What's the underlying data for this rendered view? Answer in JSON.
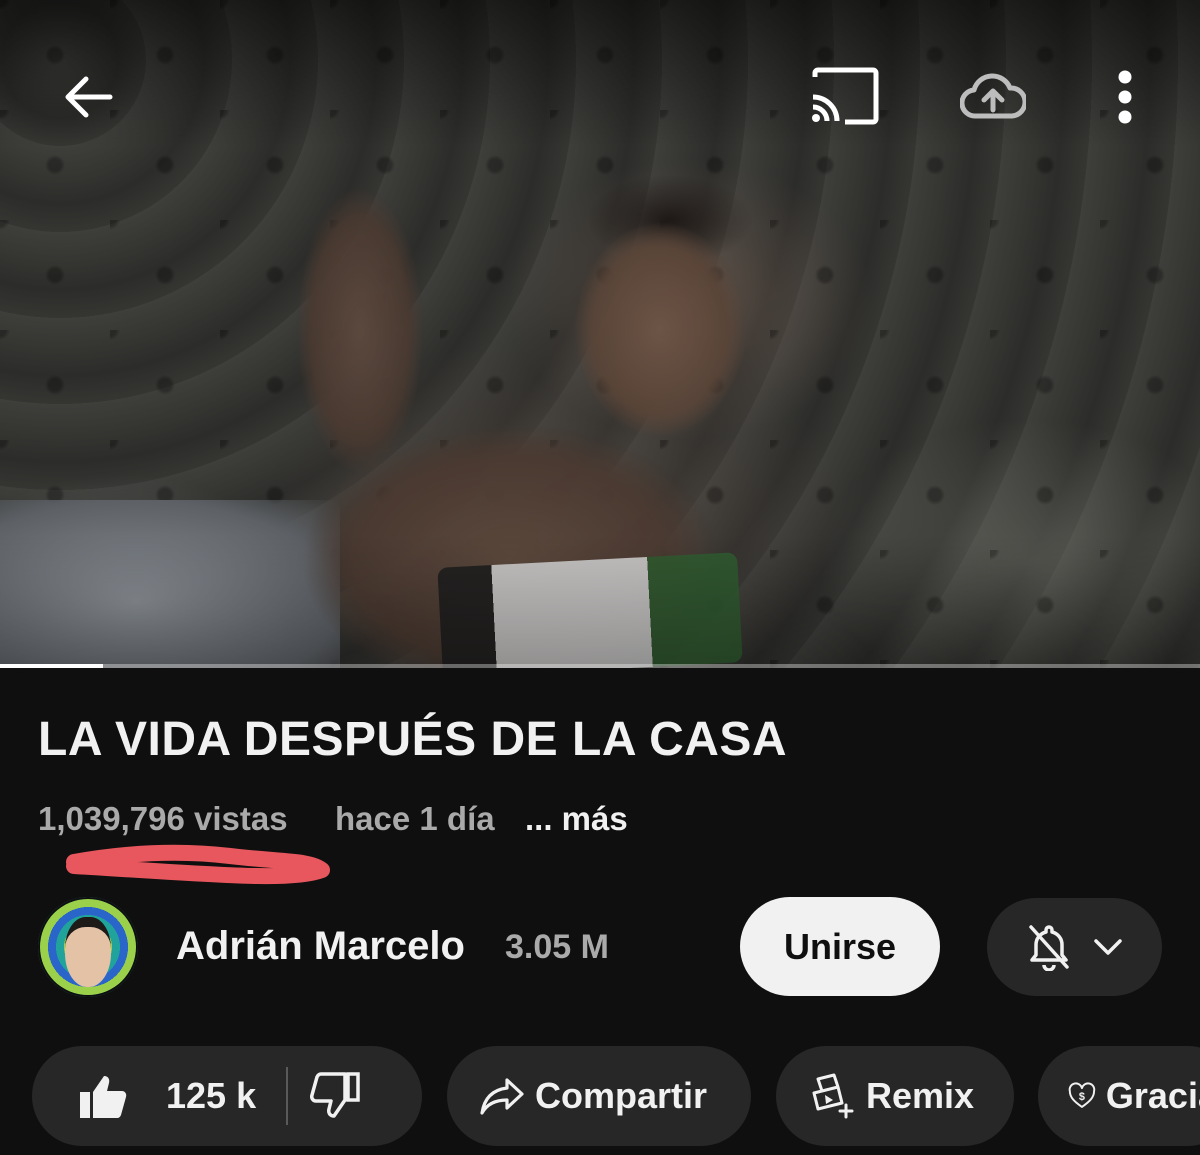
{
  "player": {
    "progress_fraction": 0.086,
    "icons": {
      "back": "arrow-left-icon",
      "cast": "cast-icon",
      "upload": "cloud-upload-icon",
      "menu": "more-vert-icon"
    }
  },
  "video": {
    "title": "LA VIDA DESPUÉS DE LA CASA",
    "views": "1,039,796 vistas",
    "time_ago": "hace 1 día",
    "more": "... más"
  },
  "annotation": {
    "color": "#e8575e"
  },
  "channel": {
    "name": "Adrián Marcelo",
    "subscribers": "3.05 M",
    "join_label": "Unirse",
    "icons": {
      "bell": "bell-off-icon",
      "chevron": "chevron-down-icon"
    }
  },
  "actions": {
    "like_count": "125 k",
    "share_label": "Compartir",
    "remix_label": "Remix",
    "thanks_label": "Gracias",
    "icons": {
      "like": "thumbs-up-icon",
      "dislike": "thumbs-down-icon",
      "share": "share-icon",
      "remix": "remix-icon",
      "thanks": "super-thanks-icon"
    }
  }
}
